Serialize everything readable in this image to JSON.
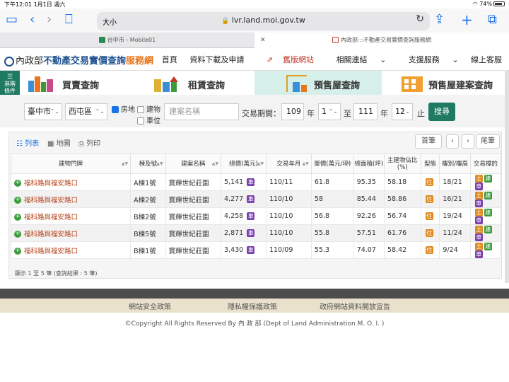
{
  "status": {
    "time": "下午12:01",
    "date": "1月1日 週六",
    "battery": "74%"
  },
  "browser": {
    "text_size": "大小",
    "url": "lvr.land.moi.gov.tw",
    "tabs": [
      {
        "label": "台中市 - Mobile01"
      },
      {
        "label": "內政部:::不動產交易實價查詢服務網"
      }
    ]
  },
  "site": {
    "logo_agency": "內政部",
    "logo_title": "不動產交易實價查詢",
    "logo_suffix": "服務網",
    "nav": [
      "首頁",
      "資料下載及申請",
      "舊版網站",
      "相關連結",
      "支援服務",
      "線上客服"
    ]
  },
  "categories": {
    "side": "進階條件",
    "items": [
      "買賣查詢",
      "租賃查詢",
      "預售屋查詢",
      "預售屋建案查詢"
    ]
  },
  "search": {
    "city": "臺中市",
    "district": "西屯區",
    "type_land": "房地",
    "type_building": "建物",
    "type_parking": "車位",
    "project_placeholder": "建案名稱",
    "period_label": "交易期間：",
    "from_year": "109",
    "year_label": "年",
    "from_month": "1",
    "to_label": "至",
    "to_year": "111",
    "to_month": "12",
    "end_label": "止",
    "search_button": "搜尋"
  },
  "results": {
    "view_list": "列表",
    "view_map": "地圖",
    "print": "列印",
    "first": "首筆",
    "prev": "‹",
    "next": "›",
    "last": "尾筆",
    "columns": [
      "建物門牌",
      "棟及號",
      "建案名稱",
      "總價(萬元)",
      "交易年月",
      "單價(萬元/坪)",
      "總面積(坪)",
      "主建物佔比(%)",
      "型態",
      "樓別/樓高",
      "交易標的"
    ],
    "rows": [
      {
        "addr": "福科路與福安路口",
        "bldg": "A棟1號",
        "project": "寶輝世紀莊園",
        "total": "5,141",
        "date": "110/11",
        "unit": "61.8",
        "area": "95.35",
        "ratio": "58.18",
        "floor": "18/21"
      },
      {
        "addr": "福科路與福安路口",
        "bldg": "A棟2號",
        "project": "寶輝世紀莊園",
        "total": "4,277",
        "date": "110/10",
        "unit": "58",
        "area": "85.44",
        "ratio": "58.86",
        "floor": "16/21"
      },
      {
        "addr": "福科路與福安路口",
        "bldg": "B棟2號",
        "project": "寶輝世紀莊園",
        "total": "4,258",
        "date": "110/10",
        "unit": "56.8",
        "area": "92.26",
        "ratio": "56.74",
        "floor": "19/24"
      },
      {
        "addr": "福科路與福安路口",
        "bldg": "B棟5號",
        "project": "寶輝世紀莊園",
        "total": "2,871",
        "date": "110/10",
        "unit": "55.8",
        "area": "57.51",
        "ratio": "61.76",
        "floor": "11/24"
      },
      {
        "addr": "福科路與福安路口",
        "bldg": "B棟1號",
        "project": "寶輝世紀莊園",
        "total": "3,430",
        "date": "110/09",
        "unit": "55.3",
        "area": "74.07",
        "ratio": "58.42",
        "floor": "9/24"
      }
    ],
    "tag_car": "車",
    "tag_type": "住",
    "tag_land": "土",
    "tag_build": "建",
    "summary": "顯示 1 至 5 筆 (查詢結果 : 5 筆)"
  },
  "footer": {
    "links": [
      "網站安全政策",
      "隱私權保護政策",
      "政府網站資料開放宣告"
    ],
    "copyright": "©Copyright All Rights Reserved By 內 政 部 (Dept of Land Administration M. O. I. )"
  }
}
